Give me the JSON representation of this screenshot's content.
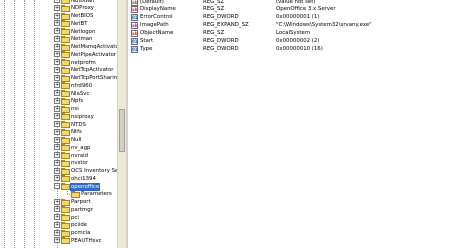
{
  "tree": {
    "nodes": [
      {
        "label": "NdisWan",
        "expanded": false
      },
      {
        "label": "NDProxy",
        "expanded": false
      },
      {
        "label": "NetBIOS",
        "expanded": false
      },
      {
        "label": "NetBT",
        "expanded": false
      },
      {
        "label": "Netlogon",
        "expanded": false
      },
      {
        "label": "Netman",
        "expanded": false
      },
      {
        "label": "NetMsmqActivator",
        "expanded": false
      },
      {
        "label": "NetPipeActivator",
        "expanded": false
      },
      {
        "label": "netprofm",
        "expanded": false
      },
      {
        "label": "NetTcpActivator",
        "expanded": false
      },
      {
        "label": "NetTcpPortSharing",
        "expanded": false
      },
      {
        "label": "nfrd960",
        "expanded": false
      },
      {
        "label": "NlaSvc",
        "expanded": false
      },
      {
        "label": "Npfs",
        "expanded": false
      },
      {
        "label": "nsi",
        "expanded": false
      },
      {
        "label": "nsiproxy",
        "expanded": false
      },
      {
        "label": "NTDS",
        "expanded": false
      },
      {
        "label": "Ntfs",
        "expanded": false
      },
      {
        "label": "Null",
        "expanded": false
      },
      {
        "label": "nv_agp",
        "expanded": false
      },
      {
        "label": "nvraid",
        "expanded": false
      },
      {
        "label": "nvstor",
        "expanded": false
      },
      {
        "label": "OCS Inventory Serv",
        "expanded": false
      },
      {
        "label": "ohci1394",
        "expanded": false
      },
      {
        "label": "openoffice",
        "expanded": true,
        "selected": true
      },
      {
        "label": "Parameters",
        "child": true
      },
      {
        "label": "Parport",
        "expanded": false
      },
      {
        "label": "partmgr",
        "expanded": false
      },
      {
        "label": "pci",
        "expanded": false
      },
      {
        "label": "pciide",
        "expanded": false
      },
      {
        "label": "pcmcia",
        "expanded": false
      },
      {
        "label": "PEAUTHsvc",
        "expanded": false
      }
    ]
  },
  "values": {
    "rows": [
      {
        "name": "(Default)",
        "type": "REG_SZ",
        "data": "(value not set)",
        "icon": "ab"
      },
      {
        "name": "DisplayName",
        "type": "REG_SZ",
        "data": "OpenOffice 3.x Server",
        "icon": "ab"
      },
      {
        "name": "ErrorControl",
        "type": "REG_DWORD",
        "data": "0x00000001 (1)",
        "icon": "bin"
      },
      {
        "name": "ImagePath",
        "type": "REG_EXPAND_SZ",
        "data": "\"C:\\Windows\\System32\\srvany.exe\"",
        "icon": "ab"
      },
      {
        "name": "ObjectName",
        "type": "REG_SZ",
        "data": "LocalSystem",
        "icon": "ab"
      },
      {
        "name": "Start",
        "type": "REG_DWORD",
        "data": "0x00000002 (2)",
        "icon": "bin"
      },
      {
        "name": "Type",
        "type": "REG_DWORD",
        "data": "0x00000010 (16)",
        "icon": "bin"
      }
    ]
  },
  "colors": {
    "selection": "#316ac5",
    "folder": "#f3d768",
    "scrollbar": "#ece9d8"
  }
}
